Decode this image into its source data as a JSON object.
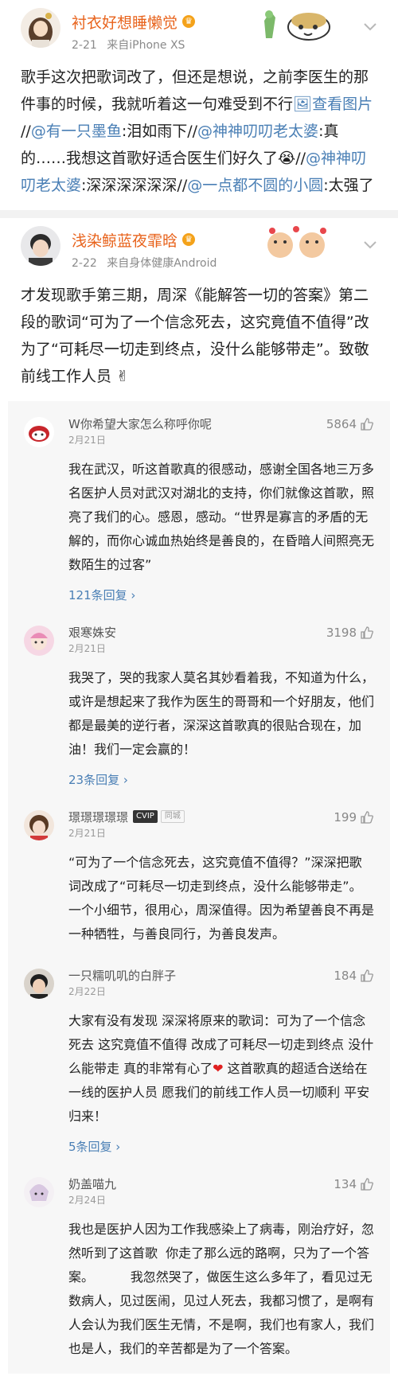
{
  "post1": {
    "username": "衬衣好想睡懒觉",
    "vip_badge": "♛",
    "date": "2-21",
    "source_prefix": "来自",
    "source": "iPhone XS",
    "text_a": "歌手这次把歌词改了，但还是想说，之前李医生的那件事的时候，我就听着这一句难受到不行",
    "view_image": "🖼查看图片",
    "text_b": " //",
    "mention1": "@有一只墨鱼",
    "text_c": ":泪如雨下//",
    "mention2": "@神神叨叨老太婆",
    "text_d": ":真的……我想这首歌好适合医生们好久了😭//",
    "mention3": "@神神叨叨老太婆",
    "text_e": ":深深深深深深//",
    "mention4": "@一点都不圆的小圆",
    "text_f": ":太强了"
  },
  "post2": {
    "username": "浅染鲸蓝夜霏晗",
    "vip_badge": "♛",
    "date": "2-22",
    "source_prefix": "来自",
    "source": "身体健康Android",
    "text": "才发现歌手第三期，周深《能解答一切的答案》第二段的歌词“可为了一个信念死去，这究竟值不值得”改为了“可耗尽一切走到终点，没什么能够带走”。致敬前线工作人员 ✌"
  },
  "comments": [
    {
      "name": "W你希望大家怎么称呼你呢",
      "date": "2月21日",
      "likes": "5864",
      "text": "我在武汉，听这首歌真的很感动，感谢全国各地三万多名医护人员对武汉对湖北的支持，你们就像这首歌，照亮了我们的心。感恩，感动。“世界是寡言的矛盾的无解的，而你心诚血热始终是善良的，在昏暗人间照亮无数陌生的过客”",
      "replies": "121条回复 ›"
    },
    {
      "name": "艰寒姝安",
      "date": "2月21日",
      "likes": "3198",
      "text": "我哭了，哭的我家人莫名其妙看着我，不知道为什么，或许是想起来了我作为医生的哥哥和一个好朋友，他们都是最美的逆行者，深深这首歌真的很贴合现在，加油！我们一定会赢的！",
      "replies": "23条回复 ›"
    },
    {
      "name": "璟璟璟璟璟",
      "vip": "CVIP",
      "city": "同城",
      "date": "2月21日",
      "likes": "199",
      "text": "“可为了一个信念死去，这究竟值不值得？”深深把歌词改成了“可耗尽一切走到终点，没什么能够带走”。一个小细节，很用心，周深值得。因为希望善良不再是一种牺牲，与善良同行，为善良发声。"
    },
    {
      "name": "一只糯叽叽的白胖子",
      "date": "2月22日",
      "likes": "184",
      "text_a": "大家有没有发现 深深将原来的歌词：可为了一个信念死去 这究竟值不值得 改成了可耗尽一切走到终点 没什么能带走 真的非常有心了",
      "heart": "❤",
      "text_b": " 这首歌真的超适合送给在一线的医护人员 愿我们的前线工作人员一切顺利 平安归来！",
      "replies": "5条回复 ›"
    },
    {
      "name": "奶盖喵九",
      "date": "2月24日",
      "likes": "134",
      "text": "我也是医护人因为工作我感染上了病毒，刚治疗好，忽然听到了这首歌  你走了那么远的路啊，只为了一个答案。         我忽然哭了，做医生这么多年了，看见过无数病人，见过医闹，见过人死去，我都习惯了，是啊有人会认为我们医生无情，不是啊，我们也有家人，我们也是人，我们的辛苦都是为了一个答案。"
    }
  ],
  "colors": {
    "username": "#e8631c",
    "link": "#4a7fb5",
    "heart": "#e02020"
  },
  "icons": {
    "chevron": "chevron-down-icon",
    "like": "thumb-up-icon",
    "image": "image-icon"
  }
}
